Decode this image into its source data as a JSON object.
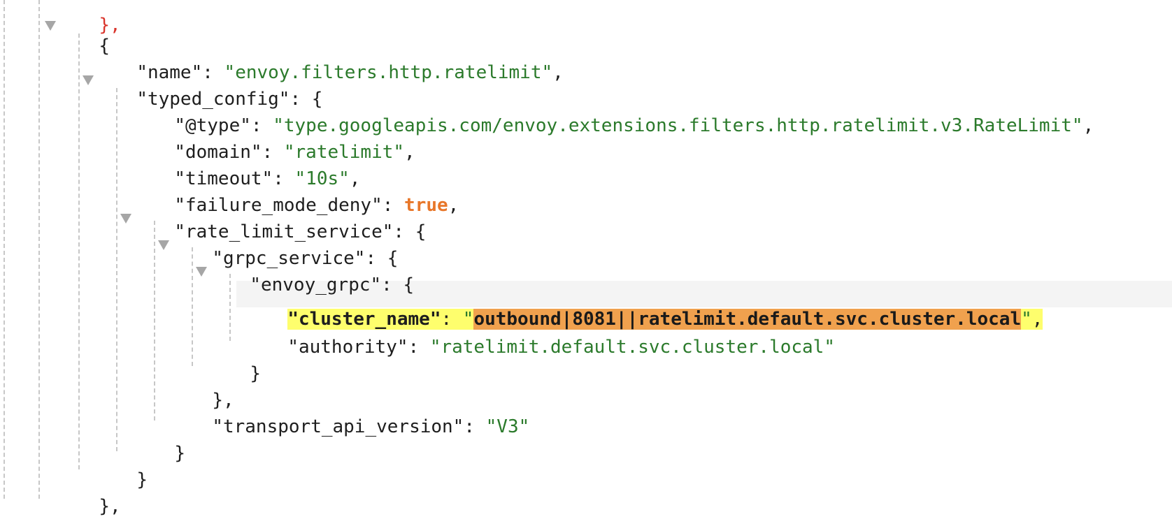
{
  "top_fragment": "},",
  "filter": {
    "open": "{",
    "name_key": "\"name\"",
    "name_value": "\"envoy.filters.http.ratelimit\"",
    "typed_config_key": "\"typed_config\"",
    "typed_config": {
      "type_key": "\"@type\"",
      "type_value": "\"type.googleapis.com/envoy.extensions.filters.http.ratelimit.v3.RateLimit\"",
      "domain_key": "\"domain\"",
      "domain_value": "\"ratelimit\"",
      "timeout_key": "\"timeout\"",
      "timeout_value": "\"10s\"",
      "failure_key": "\"failure_mode_deny\"",
      "failure_value": "true",
      "rls_key": "\"rate_limit_service\"",
      "rls": {
        "grpc_service_key": "\"grpc_service\"",
        "envoy_grpc_key": "\"envoy_grpc\"",
        "cluster_name_key": "cluster_name",
        "cluster_name_value": "outbound|8081||ratelimit.default.svc.cluster.local",
        "authority_key": "\"authority\"",
        "authority_value": "\"ratelimit.default.svc.cluster.local\"",
        "transport_key": "\"transport_api_version\"",
        "transport_value": "\"V3\""
      }
    },
    "close": "},"
  },
  "punctuation": {
    "colon": ": ",
    "comma": ",",
    "open_brace": "{",
    "close_brace": "}",
    "close_brace_comma": "},",
    "quote": "\""
  },
  "colors": {
    "string": "#2b7a2b",
    "literal": "#e8772a",
    "highlight_key": "#fefe6d",
    "highlight_value": "#f0a14e",
    "guide": "#c7c7c7"
  },
  "icons": [
    "collapse-arrow-icon"
  ]
}
